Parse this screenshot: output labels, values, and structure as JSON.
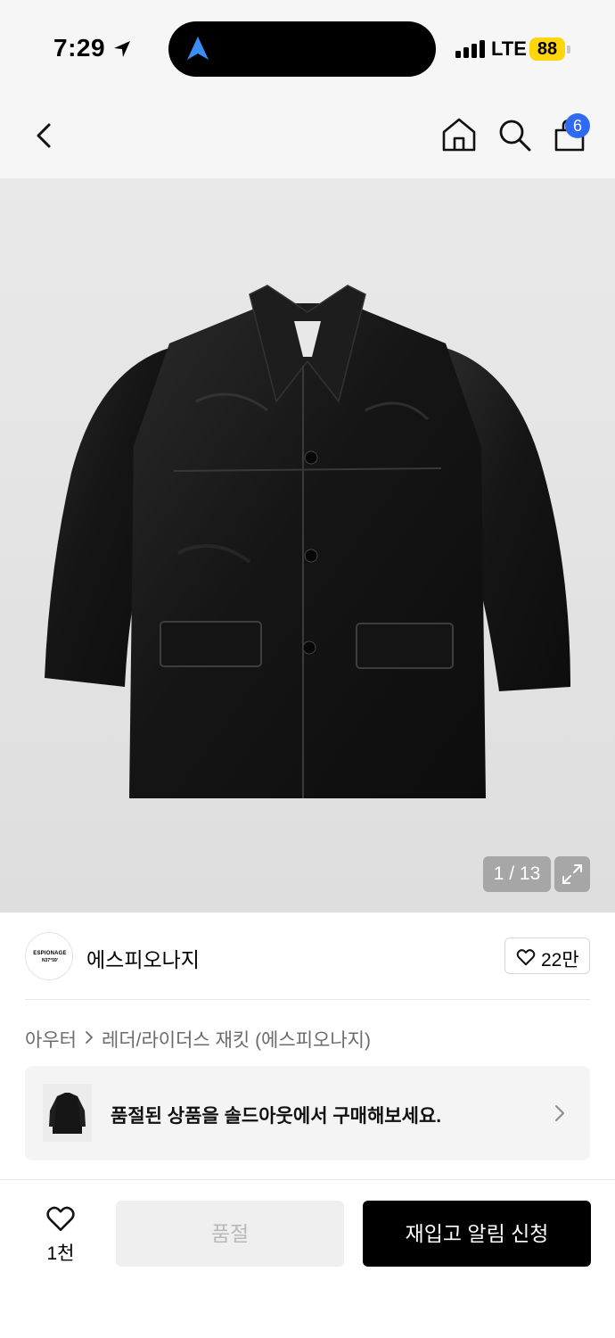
{
  "status_bar": {
    "time": "7:29",
    "network": "LTE",
    "battery": "88",
    "icons": [
      "location-arrow-icon",
      "navigation-app-icon",
      "signal-bars-icon"
    ]
  },
  "header": {
    "icons": [
      "back-chevron-icon",
      "home-icon",
      "search-icon",
      "shopping-bag-icon"
    ],
    "cart_count": "6",
    "badge_color": "#2f6bf2"
  },
  "gallery": {
    "counter": "1 / 13",
    "expand_icon": "expand-arrows-icon"
  },
  "brand": {
    "logo_line1": "ESPIONAGE",
    "logo_line2": "N37°59'",
    "name": "에스피오나지",
    "likes": "22만"
  },
  "breadcrumb": {
    "category": "아우터",
    "subcategory": "레더/라이더스 재킷 (에스피오나지)"
  },
  "soldout_banner": {
    "text": "품절된 상품을 솔드아웃에서 구매해보세요."
  },
  "bottom_bar": {
    "wish_count": "1천",
    "soldout_label": "품절",
    "restock_label": "재입고 알림 신청",
    "primary_color": "#000000"
  }
}
